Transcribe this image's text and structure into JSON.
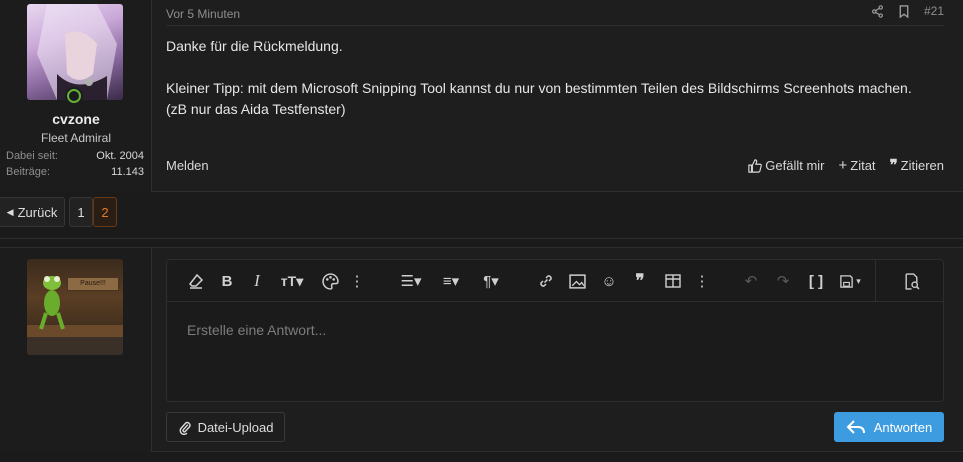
{
  "post": {
    "author": {
      "name": "cvzone",
      "title": "Fleet Admiral",
      "stats": [
        {
          "label": "Dabei seit:",
          "value": "Okt. 2004"
        },
        {
          "label": "Beiträge:",
          "value": "11.143"
        }
      ]
    },
    "date": "Vor 5 Minuten",
    "number": "#21",
    "body": [
      "Danke für die Rückmeldung.",
      "Kleiner Tipp: mit dem Microsoft Snipping Tool kannst du nur von bestimmten Teilen des Bildschirms Screenhots machen. (zB nur das Aida Testfenster)"
    ],
    "report_label": "Melden",
    "like_label": "Gefällt mir",
    "quote_add_label": "Zitat",
    "quote_label": "Zitieren"
  },
  "pagination": {
    "prev_label": "Zurück",
    "pages": [
      "1",
      "2"
    ],
    "active": "2"
  },
  "reply": {
    "avatar_sign": "Pause!!!",
    "placeholder": "Erstelle eine Antwort...",
    "upload_label": "Datei-Upload",
    "submit_label": "Antworten"
  },
  "colors": {
    "accent": "#3d9be0",
    "active_page": "#e07a2e",
    "online": "#63b03a"
  }
}
